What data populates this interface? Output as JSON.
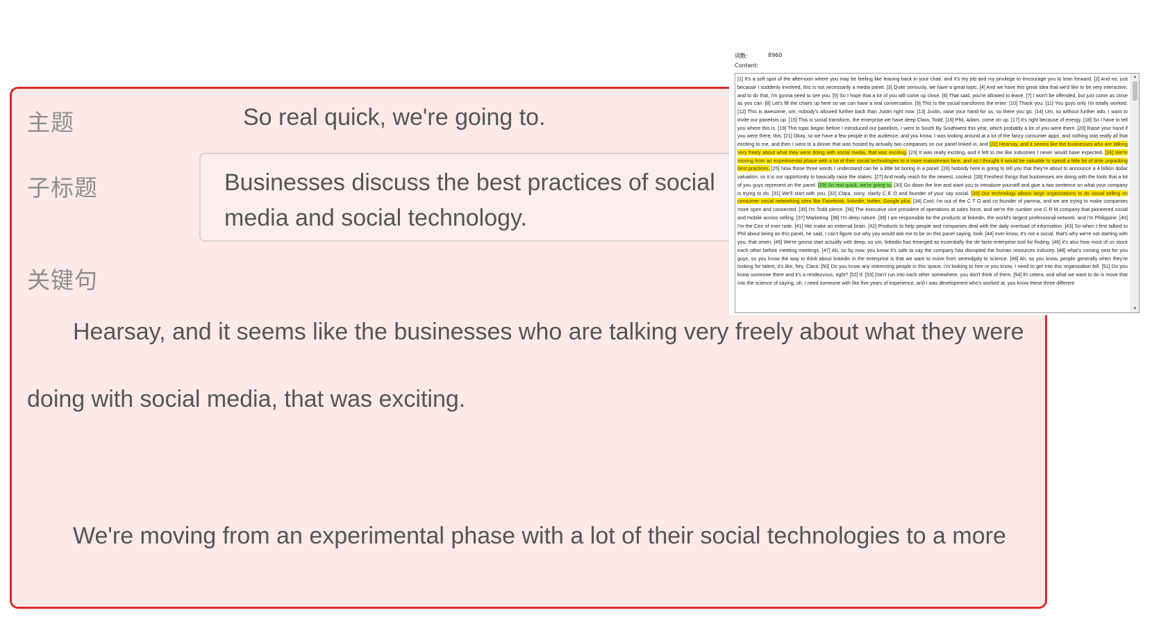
{
  "form": {
    "topic_label": "主题",
    "topic_value": "So real quick, we're going to.",
    "subtitle_label": "子标题",
    "subtitle_value": "Businesses discuss the best practices of social media and social technology.",
    "key_sentences_label": "关键句",
    "key_sentences": [
      "Hearsay, and it seems like the businesses who are talking very freely about what they were doing with social media, that was exciting.",
      "We're moving from an experimental phase with a lot of their social technologies to a more"
    ]
  },
  "document": {
    "word_count_label": "词数:",
    "word_count_value": "8960",
    "content_label": "Content:",
    "segments": [
      {
        "text": "[1] It's a soft spot of the afternoon where you may be feeling like leaning back in your chair, and it's my job and my privilege to encourage you to lean forward. [2] And no, just because I suddenly involved, this is not necessarily a media panel. [3] Quite seriously, we have a great topic. [4] And we have this great idea that we'd like to be very interactive, and to do that, i'm gonna need to see you. [5] So I hope that a lot of you will come up close. [6] That said, you're allowed to leave. [7] I won't be offended, but just come as close as you can. [8] Let's fill the chairs up here so we can have a real conversation. [9] This is the social transforms the enter. [10] Thank you. [11] You guys only i'm totally worked. [12] This is awesome, um, nobody's allowed further back than Justin right now. [13] Justin, raise your hand for us, so there you go. [14] Um, so without further ado, I want to invite our panelists up. [15] This is social transform, the enterprise we have deep Clara, Todd. [16] Phil, Adam, come on up. [17] It's right because of energy. [18] So I have to tell you where this is. [19] This topic began before I introduced our panelists, I went to South By Southwest this year, which probably a lot of you were there. [20] Raise your hand if you were there, this. [21] Okay, so we have a few people in the audience, and you know, I was looking around at a lot of the fancy consumer apps, and nothing was really all that exciting to me, and then I went to a dinner that was hosted by actually two companies on our panel linked in, and ",
        "hl": ""
      },
      {
        "text": "[22] Hearsay, and it seems like the businesses who are talking very freely about what they were doing with social media, that was exciting.",
        "hl": "yellow"
      },
      {
        "text": " [23] It was really exciting, and it felt to me like industries I never would have expected. ",
        "hl": ""
      },
      {
        "text": "[24] We're moving from an experimental phase with a lot of their social technologies to a more mainstream face, and so I thought it would be valuable to spend a little bit of time unpacking best practices.",
        "hl": "yellow"
      },
      {
        "text": " [25] Now those three words I understand can be a little bit boring in a panel. [26] Nobody here is going to tell you that they're about to announce a 4 billion dollar valuation, so it is our opportunity to basically raise the stakes. [27] And really reach for the newest, coolest. [28] Freshest things that businesses are doing with the tools that a lot of you guys represent on the panel. ",
        "hl": ""
      },
      {
        "text": "[29] So real quick, we're going to.",
        "hl": "green"
      },
      {
        "text": " [30] Go down the line and want you to introduce yourself and give a two sentence on what your company is trying to do. [31] We'll start with you. [32] Clara, sorry, clarify C E O and founder of your say social. ",
        "hl": ""
      },
      {
        "text": "[33] Our technology allows large organizations to do social selling on consumer social networking sites like Facebook, linkedin, twitter, Google plus.",
        "hl": "yellow"
      },
      {
        "text": " [34] Cool, i'm out of the C T O and co founder of yamma, and we are trying to make companies more open and connected. [35] I'm Todd pierce. [36] The executive vice president of operations at sales force, and we're the number one C R M company that pioneered social and mobile across selling. [37] Marketing. [38] I'm deep nature. [39] I am responsible for the products at linkedin, the world's largest professional network. and i'm Philippine. [40] I'm the Ceo of ever note. [41] We make an external brain. [42] Products to help people and companies deal with the daily overload of information. [43] So when I first talked to Phil about being on this panel, he said, I can't figure out why you would ask me to be on this panel saying, look. [44] ever know, it's not a social, that's why we're not starting with you, that omen. [45] We're gonna start actually with deep, so um, linkedin has emerged as essentially the de facto enterprise tool for finding. [46] it's also how most of us stock each other before meeting meetings. [47] Ah, so by now, you know it's safe to say the company has disrupted the human resources industry. [48] what's coming next for you guys, so you know the way to think about linkedin in the enterprise is that we want to move from serendipity to science. [49] Ah, so you know, people generally when they're looking for talent, it's like, hey, Clara. [50] Do you know any interesting people in this space, i'm looking to hire or you know, I need to get into this organization fell. [51] Do you know someone there and it's a rendezvous, right? [52] If. [53] Don't run into each other somewhere, you don't think of them. [54] Et cetera, and what we want to do is move that into the science of saying, oh, I need someone with like five years of experience, and I was development who's worked at, you know these three different",
        "hl": ""
      }
    ]
  },
  "colors": {
    "panel_border": "#d62a2a",
    "panel_background": "#fde9e7",
    "highlight_yellow": "#ffe500",
    "highlight_green": "#8ee06a"
  },
  "icons": {
    "scroll_up": "triangle-up",
    "scroll_down": "triangle-down"
  }
}
